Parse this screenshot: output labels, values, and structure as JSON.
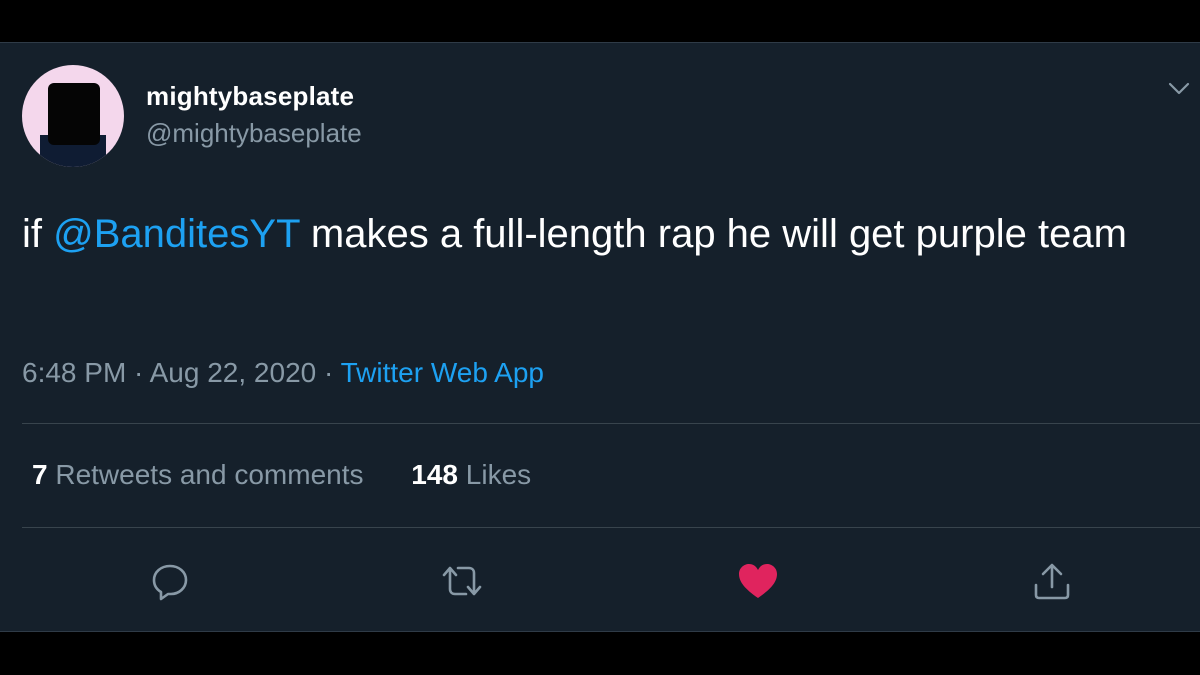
{
  "user": {
    "display_name": "mightybaseplate",
    "handle": "@mightybaseplate"
  },
  "tweet": {
    "text_before": "if ",
    "mention": "@BanditesYT",
    "text_after": " makes a full-length rap he will get purple team"
  },
  "meta": {
    "time": "6:48 PM",
    "separator": " · ",
    "date": "Aug 22, 2020",
    "separator2": " · ",
    "source": "Twitter Web App"
  },
  "stats": {
    "retweets_count": "7",
    "retweets_label": " Retweets and comments",
    "likes_count": "148",
    "likes_label": " Likes"
  },
  "icons": {
    "reply": "reply-icon",
    "retweet": "retweet-icon",
    "like": "heart-icon",
    "share": "share-icon",
    "menu": "chevron-down-icon"
  },
  "colors": {
    "background": "#15202b",
    "accent": "#1da1f2",
    "like": "#e0245e",
    "secondary_text": "#8899a6"
  }
}
